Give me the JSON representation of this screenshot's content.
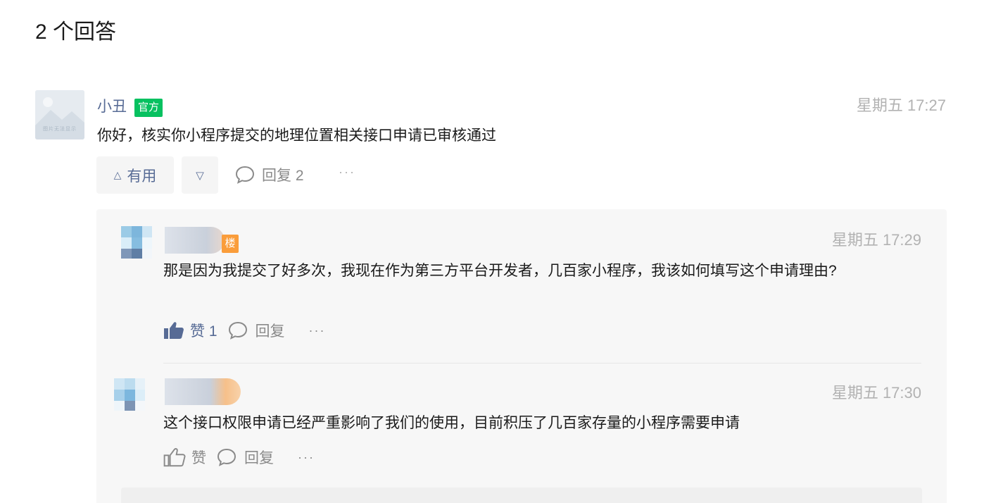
{
  "heading": "2 个回答",
  "answer": {
    "avatar_caption": "图片无法显示",
    "author": "小丑",
    "badge": "官方",
    "time": "星期五 17:27",
    "content": "你好，核实你小程序提交的地理位置相关接口申请已审核通过",
    "useful_label": "有用",
    "reply_label": "回复 2",
    "more": "···"
  },
  "replies": [
    {
      "badge": "楼",
      "time": "星期五 17:29",
      "content": "那是因为我提交了好多次，我现在作为第三方平台开发者，几百家小程序，我该如何填写这个申请理由?",
      "like_label": "赞 1",
      "liked": true,
      "reply_label": "回复",
      "more": "···"
    },
    {
      "time": "星期五 17:30",
      "content": "这个接口权限申请已经严重影响了我们的使用，目前积压了几百家存量的小程序需要申请",
      "like_label": "赞",
      "liked": false,
      "reply_label": "回复",
      "more": "···"
    }
  ],
  "colors": {
    "link": "#576b95",
    "official_badge": "#07c160",
    "floor_badge": "#fa9d3b",
    "muted": "#b2b2b2"
  }
}
